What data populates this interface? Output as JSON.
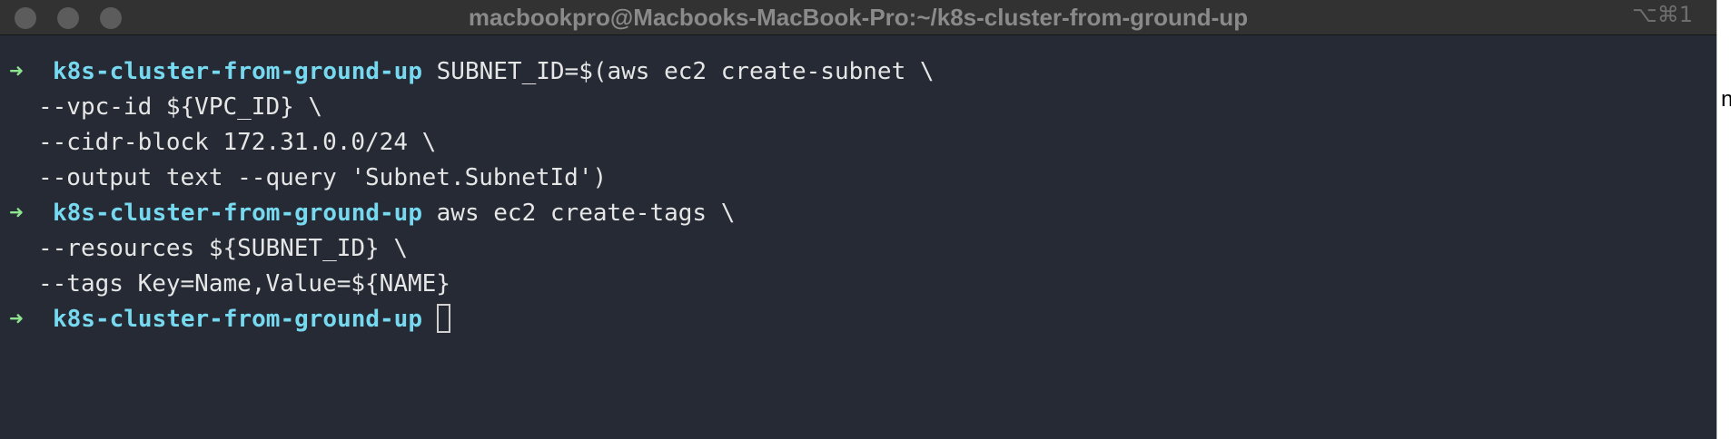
{
  "window": {
    "title": "macbookpro@Macbooks-MacBook-Pro:~/k8s-cluster-from-ground-up",
    "shortcut": "⌥⌘1",
    "background_color": "#252a34",
    "titlebar_color": "#323232"
  },
  "prompt": {
    "arrow": "➜",
    "directory": "k8s-cluster-from-ground-up",
    "arrow_color": "#8ee38f",
    "directory_color": "#76d9f0"
  },
  "terminal": {
    "cmd1": "SUBNET_ID=$(aws ec2 create-subnet \\",
    "cmd1_cont": [
      "--vpc-id ${VPC_ID} \\",
      "--cidr-block 172.31.0.0/24 \\",
      "--output text --query 'Subnet.SubnetId')"
    ],
    "cmd2": "aws ec2 create-tags \\",
    "cmd2_cont": [
      "--resources ${SUBNET_ID} \\",
      "--tags Key=Name,Value=${NAME}"
    ]
  },
  "behind_window": {
    "glyph": "n"
  }
}
